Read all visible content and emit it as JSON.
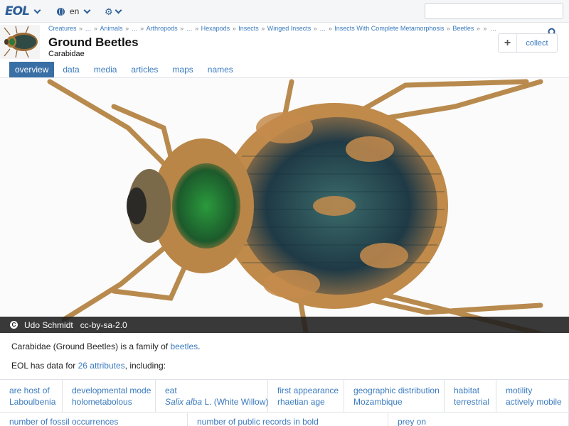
{
  "topbar": {
    "logo_text": "EOL",
    "language": "en",
    "search_placeholder": ""
  },
  "breadcrumb": [
    "Creatures",
    "…",
    "Animals",
    "…",
    "Arthropods",
    "…",
    "Hexapods",
    "Insects",
    "Winged Insects",
    "…",
    "Insects With Complete Metamorphosis",
    "Beetles",
    ""
  ],
  "page": {
    "title": "Ground Beetles",
    "subtitle": "Carabidae",
    "collect_label": "collect"
  },
  "tabs": [
    {
      "label": "overview",
      "active": true
    },
    {
      "label": "data",
      "active": false
    },
    {
      "label": "media",
      "active": false
    },
    {
      "label": "articles",
      "active": false
    },
    {
      "label": "maps",
      "active": false
    },
    {
      "label": "names",
      "active": false
    }
  ],
  "attribution": {
    "icon": "C",
    "author": "Udo Schmidt",
    "license": "cc-by-sa-2.0"
  },
  "description": {
    "line1_prefix": "Carabidae (Ground Beetles) is a family of ",
    "line1_link": "beetles",
    "line1_suffix": ".",
    "line2_prefix": "EOL has data for ",
    "line2_link": "26 attributes",
    "line2_suffix": ", including:"
  },
  "traits_row1": [
    {
      "name": "are host of",
      "value": "Laboulbenia"
    },
    {
      "name": "developmental mode",
      "value": "holometabolous"
    },
    {
      "name": "eat",
      "value_italic": "Salix alba",
      "value": " L. (White Willow)"
    },
    {
      "name": "first appearance",
      "value": "rhaetian age"
    },
    {
      "name": "geographic distribution",
      "value": "Mozambique"
    },
    {
      "name": "habitat",
      "value": "terrestrial"
    },
    {
      "name": "motility",
      "value": "actively mobile"
    }
  ],
  "traits_row2": [
    {
      "name": "number of fossil occurrences"
    },
    {
      "name": "number of public records in bold"
    },
    {
      "name": "prey on"
    }
  ],
  "colors": {
    "link": "#3b7bbf",
    "tab_active": "#3a6fa5",
    "attribution_bg": "#1e1e1e"
  }
}
